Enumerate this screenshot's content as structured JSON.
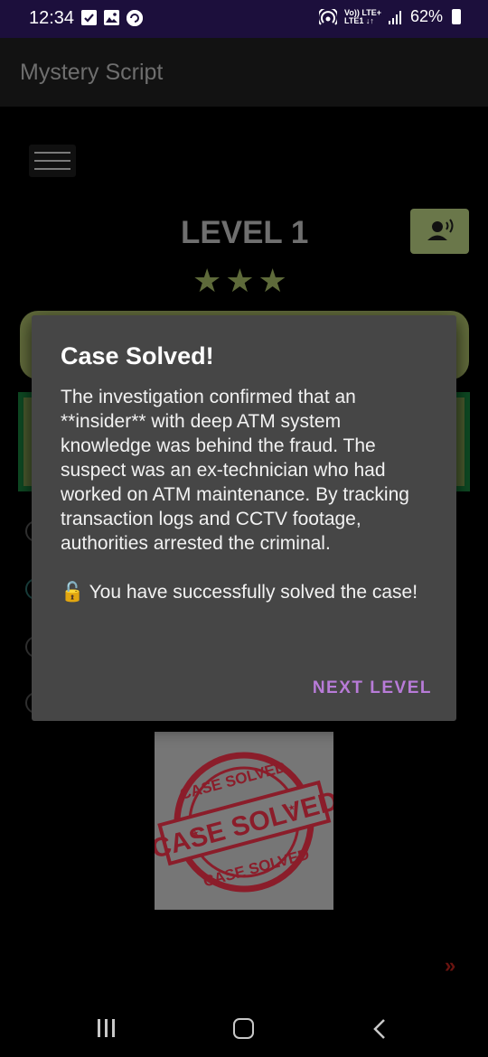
{
  "status_bar": {
    "time": "12:34",
    "network_top": "Vo)) LTE+",
    "network_bottom": "LTE1 ↓↑",
    "battery": "62%"
  },
  "app_bar": {
    "title": "Mystery Script"
  },
  "level": {
    "title": "LEVEL 1",
    "stars": "★★★",
    "star_count": 3
  },
  "dialog": {
    "title": "Case Solved!",
    "body": "The investigation confirmed that an **insider** with deep ATM system knowledge was behind the fraud. The suspect was an ex-technician who had worked on ATM maintenance. By tracking transaction logs and CCTV footage, authorities arrested the criminal.\n\n🔓 You have successfully solved the case!",
    "action": "NEXT LEVEL"
  },
  "stamp": {
    "top_text": "CASE SOLVED",
    "center_text": "CASE SOLVED",
    "bottom_text": "CASE SOLVED"
  },
  "next_arrows": "»",
  "colors": {
    "status_bar_bg": "#1c0f3c",
    "accent_olive": "#6a774a",
    "dialog_bg": "#464646",
    "action_purple": "#b87bd8",
    "stamp_red": "#8b1d2a"
  }
}
